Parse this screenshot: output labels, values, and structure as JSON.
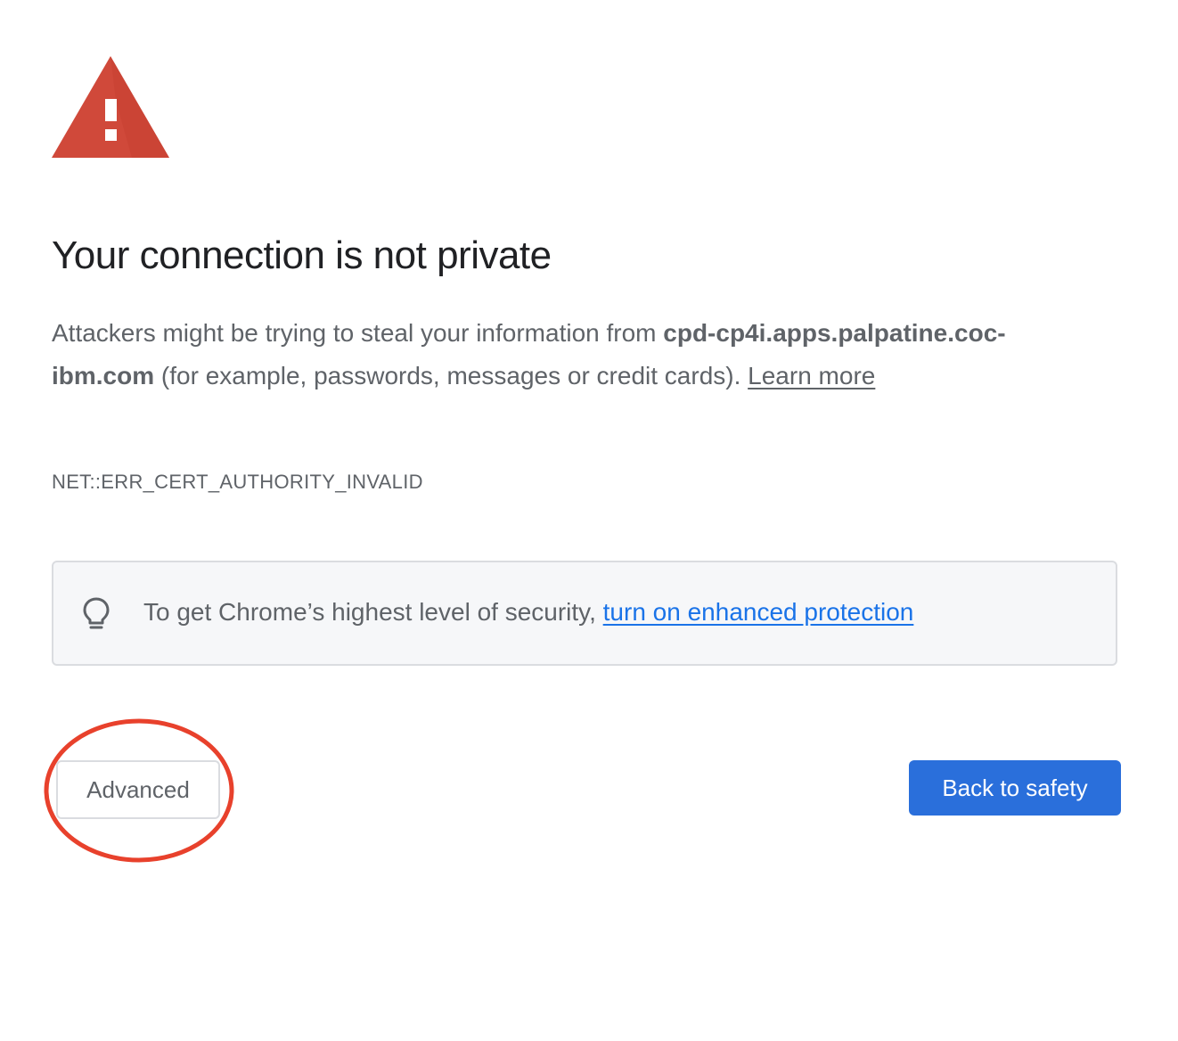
{
  "icons": {
    "warning": "warning-triangle-icon",
    "promo": "lightbulb-icon"
  },
  "colors": {
    "warning_red": "#d0493a",
    "link_blue": "#1a73e8",
    "primary_button": "#2a6fdb",
    "annotation_red": "#e8412c",
    "secondary_text": "#5f6368"
  },
  "page": {
    "title": "Your connection is not private",
    "explanation": {
      "prefix": "Attackers might be trying to steal your information from ",
      "domain": "cpd-cp4i.apps.palpatine.coc-ibm.com",
      "suffix": " (for example, passwords, messages or credit cards). ",
      "learn_more": "Learn more"
    },
    "error_code": "NET::ERR_CERT_AUTHORITY_INVALID"
  },
  "promo": {
    "text": "To get Chrome’s highest level of security, ",
    "link": "turn on enhanced protection"
  },
  "buttons": {
    "advanced": "Advanced",
    "back_to_safety": "Back to safety"
  }
}
